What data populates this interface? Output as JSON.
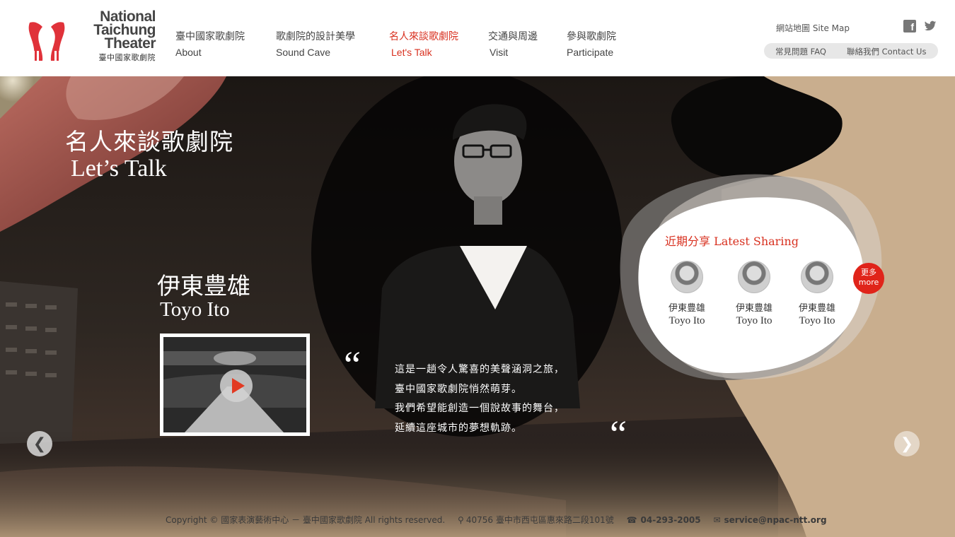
{
  "logo": {
    "en_lines": [
      "National",
      "Taichung",
      "Theater"
    ],
    "zh": "臺中國家歌劇院"
  },
  "nav": [
    {
      "zh": "臺中國家歌劇院",
      "en": "About",
      "active": false
    },
    {
      "zh": "歌劇院的設計美學",
      "en": "Sound Cave",
      "active": false
    },
    {
      "zh": "名人來談歌劇院",
      "en": "Let's Talk",
      "active": true
    },
    {
      "zh": "交通與周邊",
      "en": "Visit",
      "active": false
    },
    {
      "zh": "參與歌劇院",
      "en": "Participate",
      "active": false
    }
  ],
  "top_links": {
    "site_map": "網站地圖 Site Map",
    "faq": "常見問題 FAQ",
    "contact": "聯絡我們 Contact Us",
    "facebook_icon": "facebook-icon",
    "twitter_icon": "twitter-icon"
  },
  "hero": {
    "title_zh": "名人來談歌劇院",
    "title_en": "Let’s Talk",
    "person_zh": "伊東豊雄",
    "person_en": "Toyo Ito",
    "video_icon": "play-icon",
    "quote_open": "“",
    "quote_close": "“",
    "quote_lines": [
      "這是一趟令人驚喜的美聲涵洞之旅，",
      "臺中國家歌劇院悄然萌芽。",
      "我們希望能創造一個說故事的舞台，",
      "延續這座城市的夢想軌跡。"
    ],
    "prev_arrow": "❮",
    "next_arrow": "❯"
  },
  "latest": {
    "title": "近期分享 Latest Sharing",
    "items": [
      {
        "zh": "伊東豊雄",
        "en": "Toyo Ito"
      },
      {
        "zh": "伊東豊雄",
        "en": "Toyo Ito"
      },
      {
        "zh": "伊東豊雄",
        "en": "Toyo Ito"
      }
    ],
    "more_zh": "更多",
    "more_en": "more"
  },
  "footer": {
    "copyright": "Copyright © 國家表演藝術中心 － 臺中國家歌劇院 All rights reserved.",
    "address": "40756 臺中市西屯區惠來路二段101號",
    "phone": "04-293-2005",
    "email": "service@npac-ntt.org"
  },
  "colors": {
    "accent": "#d8301f",
    "beige": "#c9ae8e"
  }
}
